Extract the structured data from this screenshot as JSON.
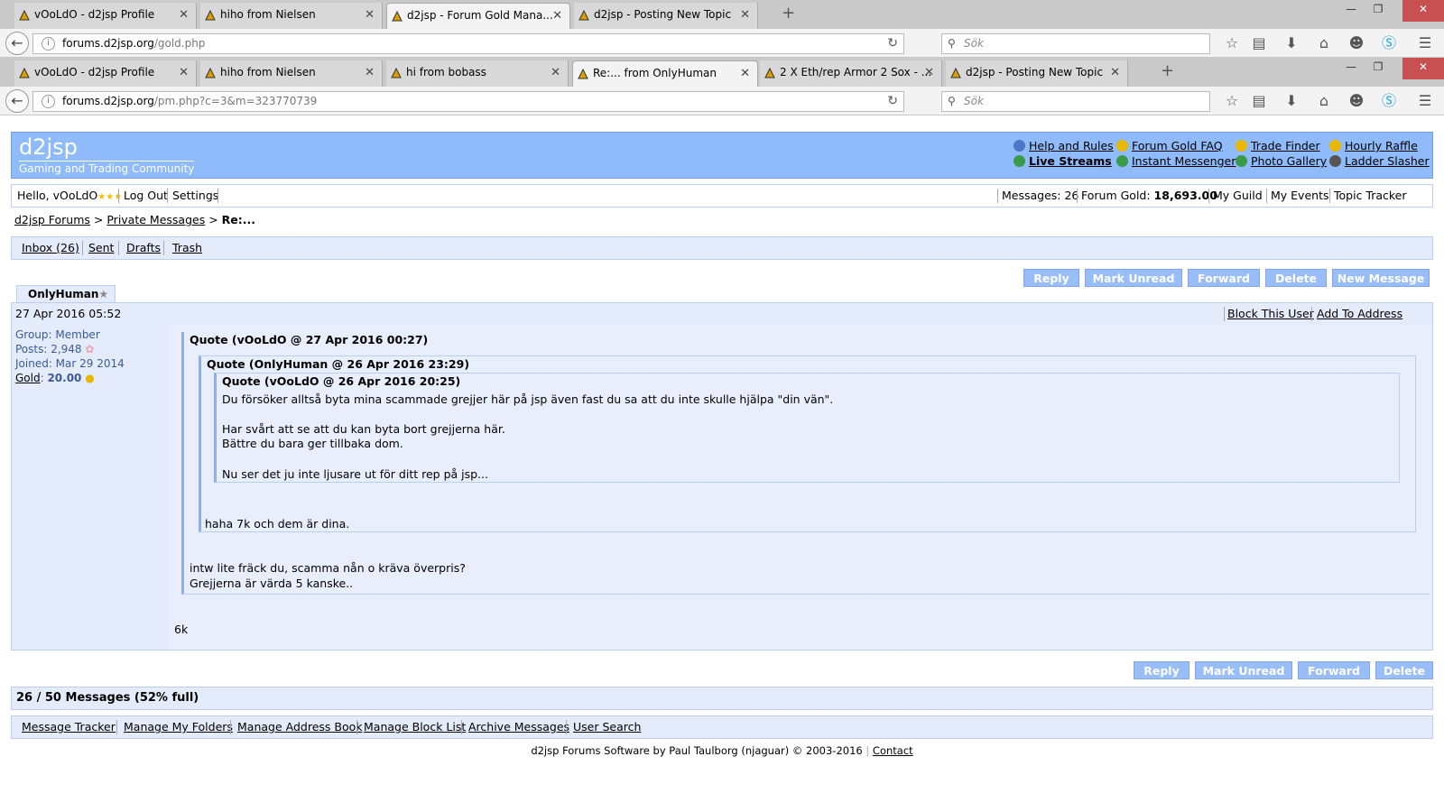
{
  "browser1": {
    "tabs": [
      {
        "label": "vOoLdO - d2jsp Profile"
      },
      {
        "label": "hiho from Nielsen"
      },
      {
        "label": "d2jsp - Forum Gold Mana..."
      },
      {
        "label": "d2jsp - Posting New Topic"
      }
    ],
    "url_host": "forums.d2jsp.org",
    "url_path": "/gold.php",
    "search_placeholder": "Sök"
  },
  "browser2": {
    "tabs": [
      {
        "label": "vOoLdO - d2jsp Profile"
      },
      {
        "label": "hiho from Nielsen"
      },
      {
        "label": "hi from bobass"
      },
      {
        "label": "Re:... from OnlyHuman"
      },
      {
        "label": "2 X Eth/rep Armor 2 Sox - ..."
      },
      {
        "label": "d2jsp - Posting New Topic"
      }
    ],
    "url_host": "forums.d2jsp.org",
    "url_path": "/pm.php?c=3&m=323770739",
    "search_placeholder": "Sök"
  },
  "header": {
    "logo": "d2jsp",
    "tagline": "Gaming and Trading Community",
    "links": {
      "help": "Help and Rules",
      "streams": "Live Streams",
      "faq": "Forum Gold FAQ",
      "im": "Instant Messenger",
      "trade": "Trade Finder",
      "photo": "Photo Gallery",
      "raffle": "Hourly Raffle",
      "ladder": "Ladder Slasher"
    }
  },
  "userbar": {
    "hello": "Hello, vOoLdO",
    "stars": "★★★",
    "logout": "Log Out",
    "settings": "Settings",
    "messages": "Messages: 26",
    "forum_gold_label": "Forum Gold:",
    "forum_gold_value": "18,693.00",
    "guild": "My Guild",
    "events": "My Events",
    "tracker": "Topic Tracker"
  },
  "breadcrumb": {
    "home": "d2jsp Forums",
    "pm": "Private Messages",
    "current": "Re:..."
  },
  "folders": {
    "inbox": "Inbox (26)",
    "sent": "Sent",
    "drafts": "Drafts",
    "trash": "Trash"
  },
  "actions": {
    "reply": "Reply",
    "mark_unread": "Mark Unread",
    "forward": "Forward",
    "delete": "Delete",
    "new_message": "New Message"
  },
  "message": {
    "sender": "OnlyHuman",
    "sender_star": "★",
    "date": "27 Apr 2016 05:52",
    "block": "Block This User",
    "address_book": "Add To Address Book",
    "group": "Group: Member",
    "posts": "Posts: 2,948",
    "joined": "Joined: Mar 29 2014",
    "gold_label": "Gold",
    "gold_value": "20.00",
    "quote1_head": "Quote (vOoLdO @ 27 Apr 2016 00:27)",
    "quote2_head": "Quote (OnlyHuman @ 26 Apr 2016 23:29)",
    "quote3_head": "Quote (vOoLdO @ 26 Apr 2016 20:25)",
    "quote3_lines": [
      "Du försöker alltså byta mina scammade grejjer här på jsp även fast du sa att du inte skulle hjälpa \"din vän\".",
      "Har svårt att se att du kan byta bort grejjerna här.",
      "Bättre du bara ger tillbaka dom.",
      "Nu ser det ju inte ljusare ut för ditt rep på jsp..."
    ],
    "quote2_text": "haha 7k och dem är dina.",
    "quote1_lines": [
      "intw lite fräck du, scamma nån o kräva överpris?",
      "Grejjerna är värda 5 kanske.."
    ],
    "reply_text": "6k"
  },
  "status": "26 / 50 Messages (52% full)",
  "tools": {
    "tracker": "Message Tracker",
    "folders": "Manage My Folders",
    "address": "Manage Address Book",
    "block": "Manage Block List",
    "archive": "Archive Messages",
    "search": "User Search"
  },
  "credits": "d2jsp Forums Software by Paul Taulborg (njaguar) © 2003-2016",
  "contact": "Contact"
}
